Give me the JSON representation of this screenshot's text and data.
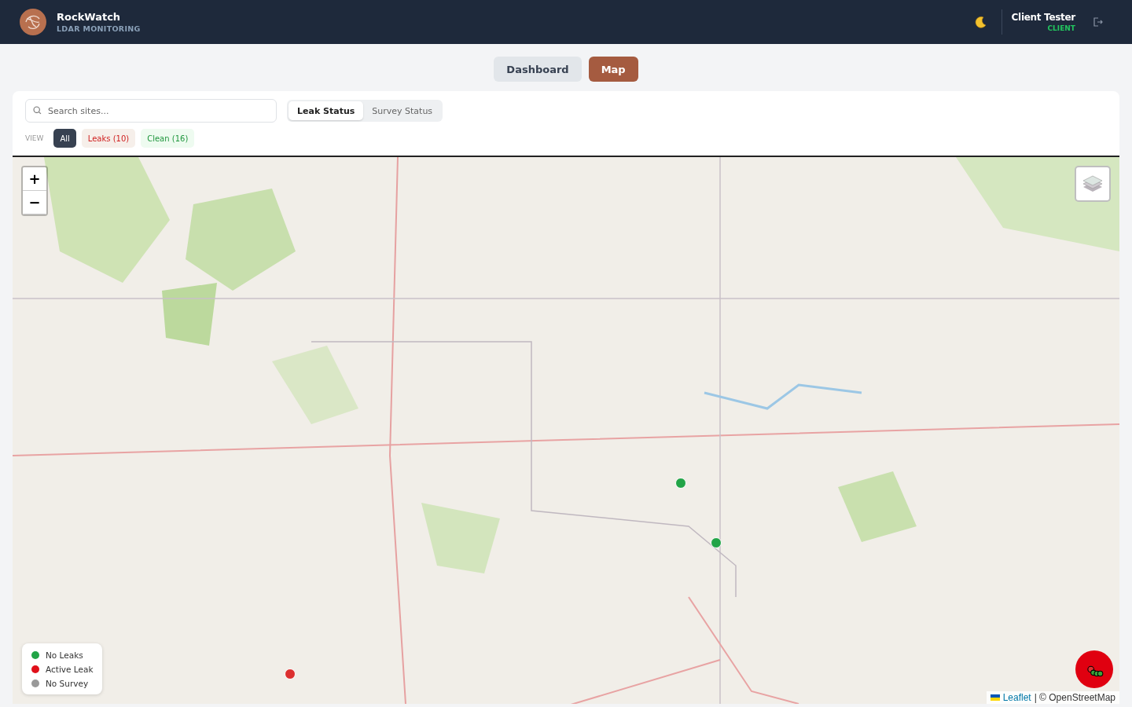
{
  "app": {
    "name": "RockWatch",
    "subtitle": "LDAR MONITORING"
  },
  "user": {
    "name": "Client Tester",
    "role": "CLIENT"
  },
  "nav": [
    {
      "label": "Dashboard",
      "selected": false
    },
    {
      "label": "Map",
      "selected": true
    }
  ],
  "search": {
    "placeholder": "Search sites..."
  },
  "mode_tabs": [
    {
      "label": "Leak Status",
      "selected": true
    },
    {
      "label": "Survey Status",
      "selected": false
    }
  ],
  "view_label": "VIEW",
  "filters": [
    {
      "label": "All",
      "kind": "all",
      "selected": true
    },
    {
      "label": "Leaks (10)",
      "kind": "leak",
      "selected": false
    },
    {
      "label": "Clean (16)",
      "kind": "clean",
      "selected": false
    }
  ],
  "map": {
    "zoom_controls": [
      "+",
      "−"
    ],
    "markers": [
      {
        "color": "#22a447"
      },
      {
        "color": "#22a447"
      },
      {
        "color": "#dc2f2f"
      }
    ],
    "legend": [
      {
        "label": "No Leaks",
        "color": "#22a447"
      },
      {
        "label": "Active Leak",
        "color": "#e0101a"
      },
      {
        "label": "No Survey",
        "color": "#999999"
      }
    ],
    "attribution": {
      "link": "Leaflet",
      "text": "| © OpenStreetMap"
    }
  }
}
